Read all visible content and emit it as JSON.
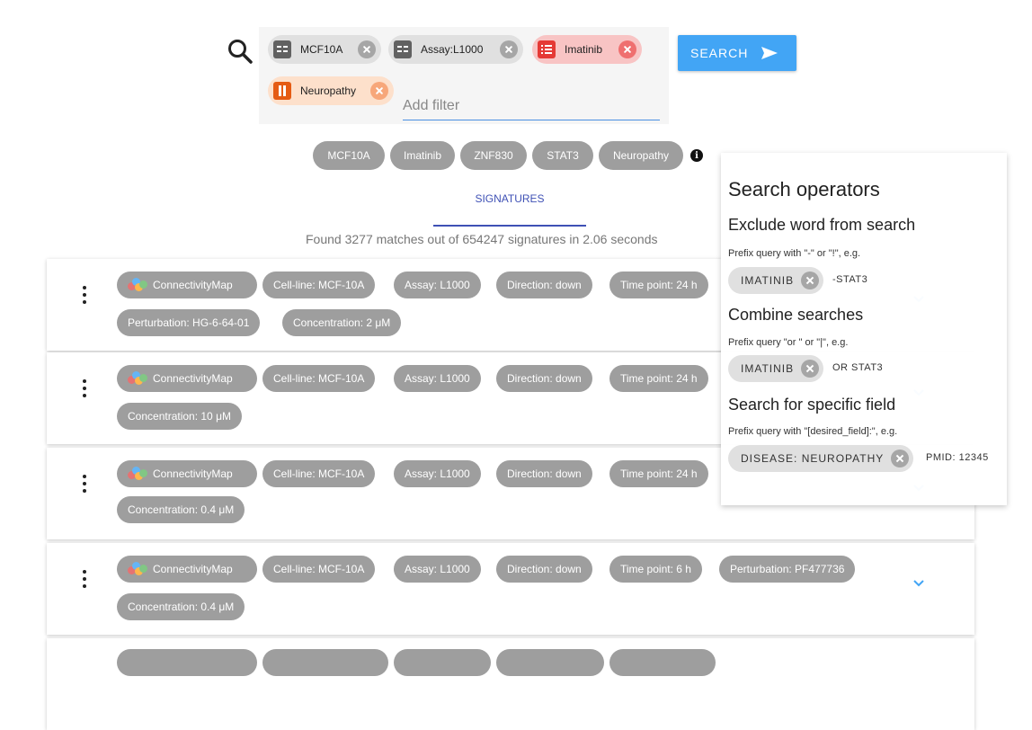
{
  "search": {
    "chips": [
      {
        "label": "MCF10A",
        "style": "grey"
      },
      {
        "label": "Assay:L1000",
        "style": "grey"
      },
      {
        "label": "Imatinib",
        "style": "red"
      },
      {
        "label": "Neuropathy",
        "style": "orange"
      }
    ],
    "placeholder": "Add filter",
    "button_label": "SEARCH"
  },
  "suggestions": [
    "MCF10A",
    "Imatinib",
    "ZNF830",
    "STAT3",
    "Neuropathy"
  ],
  "tabs": {
    "signatures": "SIGNATURES"
  },
  "found_text": "Found 3277 matches out of 654247 signatures in 2.06 seconds",
  "results": [
    {
      "library": "ConnectivityMap",
      "tags": [
        "Cell-line: MCF-10A",
        "Assay: L1000",
        "Direction: down",
        "Time point: 24 h"
      ],
      "tags_line2": [
        "Perturbation: HG-6-64-01",
        "Concentration: 2 μM"
      ]
    },
    {
      "library": "ConnectivityMap",
      "tags": [
        "Cell-line: MCF-10A",
        "Assay: L1000",
        "Direction: down",
        "Time point: 24 h"
      ],
      "tags_line2": [
        "Concentration: 10 μM"
      ]
    },
    {
      "library": "ConnectivityMap",
      "tags": [
        "Cell-line: MCF-10A",
        "Assay: L1000",
        "Direction: down",
        "Time point: 24 h"
      ],
      "tags_line2": [
        "Concentration: 0.4 μM"
      ]
    },
    {
      "library": "ConnectivityMap",
      "tags": [
        "Cell-line: MCF-10A",
        "Assay: L1000",
        "Direction: down",
        "Time point: 6 h",
        "Perturbation: PF477736"
      ],
      "tags_line2": [
        "Concentration: 0.4 μM"
      ]
    }
  ],
  "operators": {
    "title": "Search operators",
    "exclude": {
      "heading": "Exclude word from search",
      "hint": "Prefix query with \"-\" or \"!\", e.g.",
      "chip": "IMATINIB",
      "after": "-STAT3"
    },
    "combine": {
      "heading": "Combine searches",
      "hint": "Prefix query \"or \" or \"|\", e.g.",
      "chip": "IMATINIB",
      "after": "OR STAT3"
    },
    "field": {
      "heading": "Search for specific field",
      "hint": "Prefix query with \"[desired_field]:\", e.g.",
      "chip": "DISEASE: NEUROPATHY",
      "after": "PMID: 12345"
    }
  },
  "colors": {
    "accent": "#42a5f5",
    "tab_indicator": "#3f51b5",
    "tag_grey": "#9e9e9e"
  }
}
